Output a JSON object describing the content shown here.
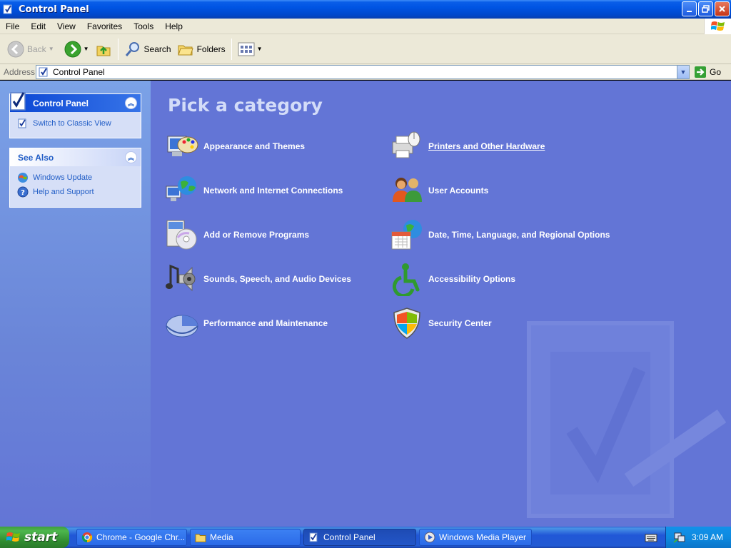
{
  "window": {
    "title": "Control Panel"
  },
  "menu": [
    "File",
    "Edit",
    "View",
    "Favorites",
    "Tools",
    "Help"
  ],
  "toolbar": {
    "back": "Back",
    "search": "Search",
    "folders": "Folders"
  },
  "address": {
    "label": "Address",
    "value": "Control Panel",
    "go": "Go"
  },
  "sidebar": {
    "panel_title": "Control Panel",
    "switch_view": "Switch to Classic View",
    "see_also_title": "See Also",
    "see_also": [
      "Windows Update",
      "Help and Support"
    ]
  },
  "main": {
    "heading": "Pick a category",
    "categories": [
      "Appearance and Themes",
      "Network and Internet Connections",
      "Add or Remove Programs",
      "Sounds, Speech, and Audio Devices",
      "Performance and Maintenance",
      "Printers and Other Hardware",
      "User Accounts",
      "Date, Time, Language, and Regional Options",
      "Accessibility Options",
      "Security Center"
    ]
  },
  "taskbar": {
    "start": "start",
    "tasks": [
      "Chrome - Google Chr...",
      "Media",
      "Control Panel",
      "Windows Media Player"
    ],
    "clock": "3:09 AM"
  },
  "colors": {
    "content_bg": "#6375d6",
    "title_bar": "#0054e3",
    "start_green": "#3f9f3f",
    "link_blue": "#215dc6"
  }
}
